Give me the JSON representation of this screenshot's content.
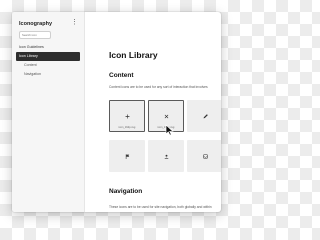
{
  "app": {
    "title": "Iconography"
  },
  "sidebar": {
    "search_placeholder": "Search icon",
    "items": [
      {
        "label": "Icon Guidelines"
      },
      {
        "label": "Icon Library"
      },
      {
        "label": "Content"
      },
      {
        "label": "Navigation"
      }
    ]
  },
  "main": {
    "title": "Icon Library",
    "sections": {
      "content": {
        "heading": "Content",
        "description": "Content icons are to be used for any sort of interaction that involves"
      },
      "navigation": {
        "heading": "Navigation",
        "description": "These icons are to be used for site navigation, both globally and within"
      }
    },
    "tiles": [
      {
        "icon": "add-icon",
        "caption": "icon_16dp.svg",
        "caption_prefix": "",
        "highlighted": true
      },
      {
        "icon": "close-icon",
        "caption": "icon_16dp.svg",
        "caption_prefix": "",
        "highlighted": true
      },
      {
        "icon": "edit-icon",
        "caption": "",
        "highlighted": false
      },
      {
        "icon": "flag-icon",
        "caption": "",
        "highlighted": false
      },
      {
        "icon": "upload-icon",
        "caption": "",
        "highlighted": false
      },
      {
        "icon": "inbox-icon",
        "caption": "",
        "highlighted": false
      }
    ]
  },
  "colors": {
    "active_nav_bg": "#2e2e2e",
    "tile_bg": "#eeeeee",
    "tile_border": "#5a5a5a"
  }
}
